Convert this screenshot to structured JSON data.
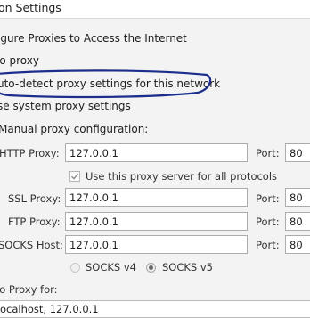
{
  "window": {
    "title": "on Settings"
  },
  "section": {
    "heading": "igure Proxies to Access the Internet"
  },
  "options": {
    "no_proxy": "lo proxy",
    "auto_detect": "uto-detect proxy settings for this network",
    "system": "se system proxy settings",
    "manual": "Manual proxy configuration:"
  },
  "http": {
    "label": "HTTP Proxy:",
    "value": "127.0.0.1",
    "port_label": "Port:",
    "port_value": "80"
  },
  "use_all": {
    "label": "Use this proxy server for all protocols",
    "checked": true
  },
  "ssl": {
    "label": "SSL Proxy:",
    "value": "127.0.0.1",
    "port_label": "Port:",
    "port_value": "80"
  },
  "ftp": {
    "label": "FTP Proxy:",
    "value": "127.0.0.1",
    "port_label": "Port:",
    "port_value": "80"
  },
  "socks": {
    "label": "SOCKS Host:",
    "value": "127.0.0.1",
    "port_label": "Port:",
    "port_value": "80"
  },
  "socks_version": {
    "v4": "SOCKS v4",
    "v5": "SOCKS v5",
    "selected": "v5"
  },
  "no_proxy_for": {
    "label": "lo Proxy for:",
    "value": "ocalhost, 127.0.0.1"
  },
  "annotation": {
    "color": "#1c2e8c"
  }
}
